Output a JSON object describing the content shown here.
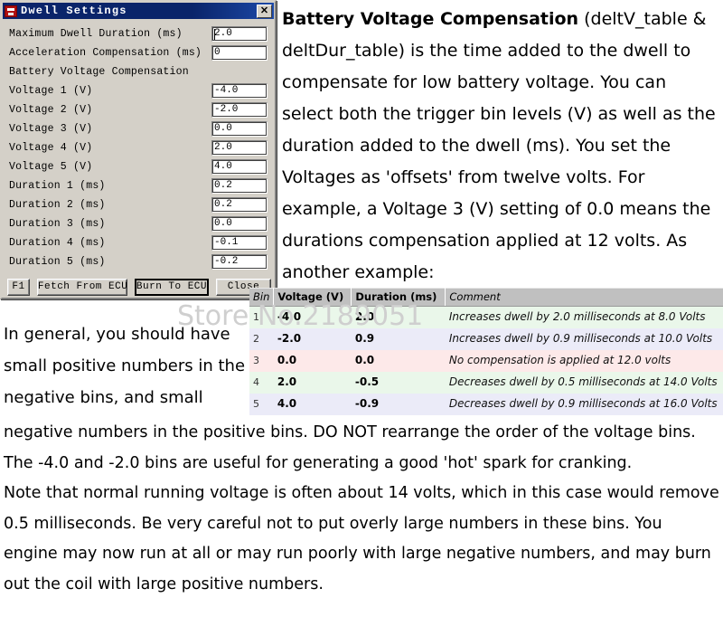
{
  "dialog": {
    "title": "Dwell Settings",
    "icon": "app-icon",
    "close_label": "✕",
    "section_label": "Battery Voltage Compensation",
    "fields": [
      {
        "label": "Maximum Dwell Duration (ms)",
        "value": "2.0"
      },
      {
        "label": "Acceleration Compensation (ms)",
        "value": "0"
      },
      {
        "label": "Voltage 1 (V)",
        "value": "-4.0"
      },
      {
        "label": "Voltage 2 (V)",
        "value": "-2.0"
      },
      {
        "label": "Voltage 3 (V)",
        "value": "0.0"
      },
      {
        "label": "Voltage 4 (V)",
        "value": "2.0"
      },
      {
        "label": "Voltage 5 (V)",
        "value": "4.0"
      },
      {
        "label": "Duration 1 (ms)",
        "value": "0.2"
      },
      {
        "label": "Duration 2 (ms)",
        "value": "0.2"
      },
      {
        "label": "Duration 3 (ms)",
        "value": "0.0"
      },
      {
        "label": "Duration 4 (ms)",
        "value": "-0.1"
      },
      {
        "label": "Duration 5 (ms)",
        "value": "-0.2"
      }
    ],
    "buttons": {
      "f1": "F1",
      "fetch": "Fetch From ECU",
      "burn": "Burn To ECU",
      "close": "Close"
    }
  },
  "article": {
    "heading": "Battery Voltage Compensation",
    "intro_rest": " (deltV_table & deltDur_table) is the time added to the dwell to compensate for low battery voltage. You can select both the trigger bin levels (V) as well as the duration added to the dwell (ms). You set the Voltages as 'offsets' from twelve volts. For example, a Voltage 3 (V) setting of 0.0 means the durations compensation applied at 12 volts. As another example:",
    "left_note": "In general, you should have small positive numbers in the negative bins, and small",
    "bottom_para1": "negative numbers in the positive bins. DO NOT rearrange the order of the voltage bins.",
    "bottom_para2": "The -4.0 and -2.0 bins are useful for generating a good 'hot' spark for cranking.",
    "bottom_para3": "Note that normal running voltage is often about 14 volts, which in this case would remove 0.5 milliseconds. Be very careful not to put overly large numbers in these bins. You engine may now run at all or may run poorly with large negative numbers, and may burn out the coil with large positive numbers."
  },
  "table": {
    "headers": [
      "Bin",
      "Voltage (V)",
      "Duration (ms)",
      "Comment"
    ],
    "rows": [
      {
        "bin": "1",
        "voltage": "-4.0",
        "duration": "2.0",
        "comment": "Increases dwell by 2.0 milliseconds at 8.0 Volts"
      },
      {
        "bin": "2",
        "voltage": "-2.0",
        "duration": "0.9",
        "comment": "Increases dwell by 0.9 milliseconds at 10.0 Volts"
      },
      {
        "bin": "3",
        "voltage": "0.0",
        "duration": "0.0",
        "comment": "No compensation is applied at 12.0 volts"
      },
      {
        "bin": "4",
        "voltage": "2.0",
        "duration": "-0.5",
        "comment": "Decreases dwell by 0.5 milliseconds at 14.0 Volts"
      },
      {
        "bin": "5",
        "voltage": "4.0",
        "duration": "-0.9",
        "comment": "Decreases dwell by 0.9 milliseconds at 16.0 Volts"
      }
    ]
  },
  "watermark": {
    "text": "Store No.2189051"
  },
  "colors": {
    "titlebar": "#0a246a",
    "dialog_face": "#d4d0c8",
    "row_green": "#eaf7ea",
    "row_lavender": "#ebebf8",
    "row_pink": "#fde9e9",
    "header_gray": "#c0c0c0",
    "watermark": "#cfcfcf"
  }
}
